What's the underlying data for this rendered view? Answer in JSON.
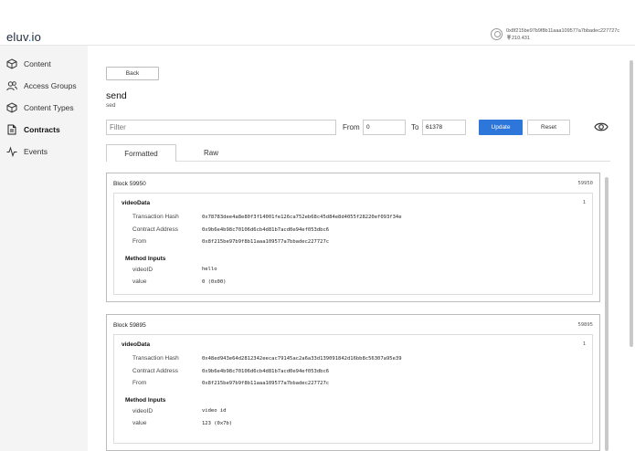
{
  "header": {
    "logo_main": "eluv",
    "logo_dot": ".",
    "logo_end": "io",
    "account_address": "0x8f215be97b9f8b11aaa109577a7bbadec227727c",
    "account_balance": "210.431",
    "balance_icon": "currency-icon"
  },
  "sidebar": {
    "items": [
      {
        "label": "Content",
        "icon": "cube-icon",
        "active": false
      },
      {
        "label": "Access Groups",
        "icon": "users-icon",
        "active": false
      },
      {
        "label": "Content Types",
        "icon": "cube-icon",
        "active": false
      },
      {
        "label": "Contracts",
        "icon": "document-icon",
        "active": true
      },
      {
        "label": "Events",
        "icon": "pulse-icon",
        "active": false
      }
    ]
  },
  "main": {
    "back_label": "Back",
    "method_name": "send",
    "method_sub": "sed",
    "filter_placeholder": "Filter",
    "from_label": "From",
    "from_value": "0",
    "to_label": "To",
    "to_value": "61378",
    "update_label": "Update",
    "reset_label": "Reset",
    "tabs": [
      {
        "label": "Formatted",
        "active": true
      },
      {
        "label": "Raw",
        "active": false
      }
    ]
  },
  "blocks": [
    {
      "title": "Block 59950",
      "number": "59950",
      "event_name": "videoData",
      "event_count": "1",
      "tx_label": "Transaction Hash",
      "tx_hash": "0x78783dee4a8e80f3f14001fe126ca752eb68c45d84e8d4055f28220ef093f34e",
      "contract_label": "Contract Address",
      "contract_address": "0x9b6e4b98c70106d6cb4d81b7acd0e94ef053dbc6",
      "from_label": "From",
      "from_address": "0x8f215be97b9f8b11aaa109577a7bbadec227727c",
      "inputs_title": "Method Inputs",
      "inputs": [
        {
          "name": "videoID",
          "value": "hello"
        },
        {
          "name": "value",
          "value": "0 (0x00)"
        }
      ]
    },
    {
      "title": "Block 59895",
      "number": "59895",
      "event_name": "videoData",
      "event_count": "1",
      "tx_label": "Transaction Hash",
      "tx_hash": "0x48ed943e64d2812342eecac79145ac2a6a33d139091842d16bb8c56307a95e39",
      "contract_label": "Contract Address",
      "contract_address": "0x9b6e4b98c70106d6cb4d81b7acd0e94ef053dbc6",
      "from_label": "From",
      "from_address": "0x8f215be97b9f8b11aaa109577a7bbadec227727c",
      "inputs_title": "Method Inputs",
      "inputs": [
        {
          "name": "videoID",
          "value": "video id"
        },
        {
          "name": "value",
          "value": "123 (0x7b)"
        }
      ]
    }
  ],
  "colors": {
    "accent": "#2d77db",
    "sidebar_bg": "#f4f4f4"
  }
}
